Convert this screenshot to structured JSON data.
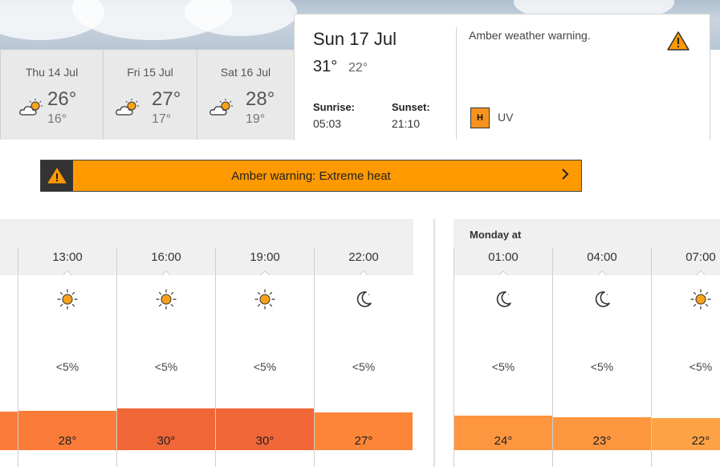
{
  "days": [
    {
      "date": "Thu 14 Jul",
      "high": "26°",
      "low": "16°",
      "icon": "sunny-intervals-icon"
    },
    {
      "date": "Fri 15 Jul",
      "high": "27°",
      "low": "17°",
      "icon": "sunny-intervals-icon"
    },
    {
      "date": "Sat 16 Jul",
      "high": "28°",
      "low": "19°",
      "icon": "sunny-intervals-icon"
    }
  ],
  "selected_day": {
    "date": "Sun 17 Jul",
    "high": "31°",
    "low": "22°",
    "sunrise_label": "Sunrise:",
    "sunrise": "05:03",
    "sunset_label": "Sunset:",
    "sunset": "21:10",
    "warning_text": "Amber weather warning.",
    "uv_badge": "H",
    "uv_label": "UV"
  },
  "warning_bar": {
    "text": "Amber warning: Extreme heat",
    "color": "#ff9900"
  },
  "hourly_today": [
    {
      "time": "13:00",
      "icon": "sun-icon",
      "precip": "<5%",
      "temp": "28°",
      "color": "#fb7c38"
    },
    {
      "time": "16:00",
      "icon": "sun-icon",
      "precip": "<5%",
      "temp": "30°",
      "color": "#f16637"
    },
    {
      "time": "19:00",
      "icon": "sun-icon",
      "precip": "<5%",
      "temp": "30°",
      "color": "#f16637"
    },
    {
      "time": "22:00",
      "icon": "moon-icon",
      "precip": "<5%",
      "temp": "27°",
      "color": "#fc8538"
    }
  ],
  "hourly_monday": {
    "label": "Monday at",
    "hours": [
      {
        "time": "01:00",
        "icon": "moon-icon",
        "precip": "<5%",
        "temp": "24°",
        "color": "#fd963e"
      },
      {
        "time": "04:00",
        "icon": "moon-icon",
        "precip": "<5%",
        "temp": "23°",
        "color": "#fd963e"
      },
      {
        "time": "07:00",
        "icon": "sun-icon",
        "precip": "<5%",
        "temp": "22°",
        "color": "#fea345"
      }
    ]
  },
  "colors": {
    "amber": "#ff9900",
    "uv_high": "#f7941d"
  }
}
